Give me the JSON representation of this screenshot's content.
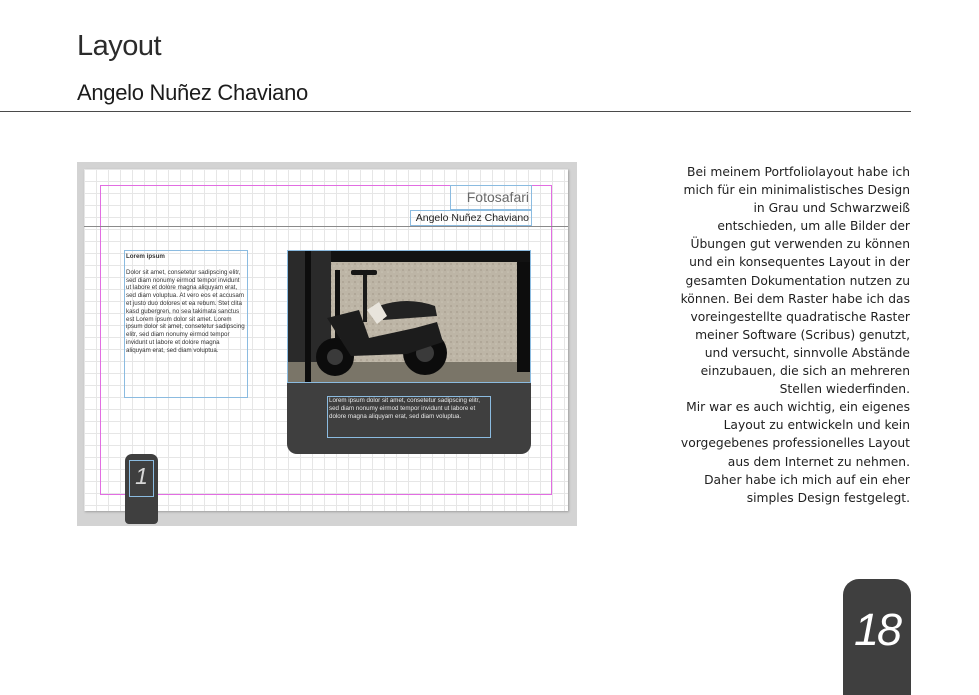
{
  "header": {
    "title": "Layout",
    "author": "Angelo Nuñez Chaviano"
  },
  "preview": {
    "mini_title": "Fotosafari",
    "mini_author": "Angelo Nuñez Chaviano",
    "text_heading": "Lorem ipsum",
    "text_body": "Dolor sit amet, consetetur sadipscing elitr, sed diam nonumy eirmod tempor invidunt ut labore et dolore magna aliquyam erat, sed diam voluptua. At vero eos et accusam et justo duo dolores et ea rebum. Stet clita kasd gubergren, no sea takimata sanctus est Lorem ipsum dolor sit amet. Lorem ipsum dolor sit amet, consetetur sadipscing elitr, sed diam nonumy eirmod tempor invidunt ut labore et dolore magna aliquyam erat, sed diam voluptua.",
    "caption": "Lorem ipsum dolor sit amet, consetetur sadipscing elitr, sed diam nonumy eirmod tempor invidunt ut labore et dolore magna aliquyam erat, sed diam voluptua.",
    "page_tab_number": "1"
  },
  "description_lines": [
    "Bei meinem Portfoliolayout habe ich",
    "mich für ein minimalistisches Design",
    "in Grau und Schwarzweiß",
    "entschieden, um alle Bilder der",
    "Übungen gut verwenden zu können",
    "und ein konsequentes Layout in der",
    "gesamten Dokumentation nutzen zu",
    "können. Bei dem Raster habe ich das",
    "voreingestellte quadratische Raster",
    "meiner Software (Scribus) genutzt,",
    "und versucht, sinnvolle Abstände",
    "einzubauen, die sich an mehreren",
    "Stellen wiederfinden.",
    "Mir war es auch wichtig, ein eigenes",
    "Layout zu entwickeln und kein",
    "vorgegebenes professionelles Layout",
    "aus dem Internet zu nehmen.",
    "Daher habe ich mich auf ein eher",
    "simples Design festgelegt."
  ],
  "page_number": "18",
  "colors": {
    "dark_gray": "#3f3f3f",
    "guide_magenta": "#e26de2",
    "frame_blue": "#8bbbe0"
  }
}
